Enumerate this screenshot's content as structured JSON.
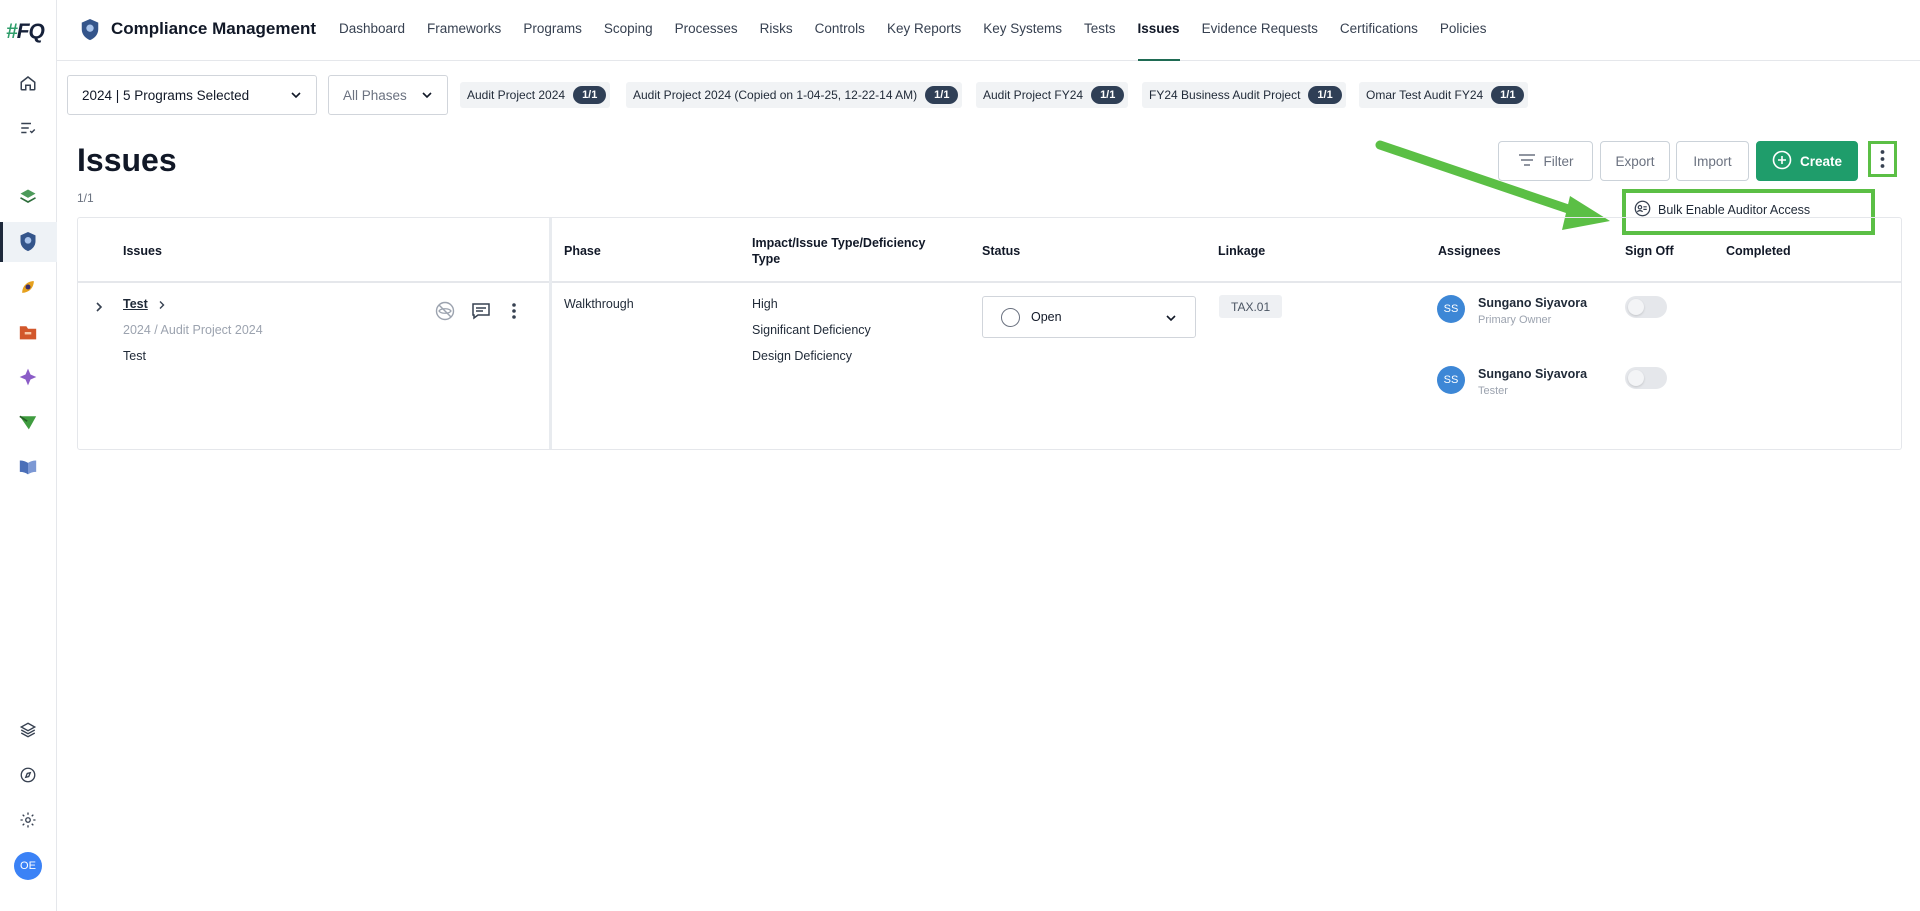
{
  "app": {
    "logo_hash": "#",
    "logo_text": "FQ",
    "title": "Compliance Management"
  },
  "nav": [
    {
      "label": "Dashboard"
    },
    {
      "label": "Frameworks"
    },
    {
      "label": "Programs"
    },
    {
      "label": "Scoping"
    },
    {
      "label": "Processes"
    },
    {
      "label": "Risks"
    },
    {
      "label": "Controls"
    },
    {
      "label": "Key Reports"
    },
    {
      "label": "Key Systems"
    },
    {
      "label": "Tests"
    },
    {
      "label": "Issues",
      "active": true
    },
    {
      "label": "Evidence Requests"
    },
    {
      "label": "Certifications"
    },
    {
      "label": "Policies"
    }
  ],
  "filters": {
    "program_select": "2024 | 5 Programs Selected",
    "phase_select": "All Phases",
    "chips": [
      {
        "label": "Audit Project 2024",
        "badge": "1/1"
      },
      {
        "label": "Audit Project 2024 (Copied on 1-04-25, 12-22-14 AM)",
        "badge": "1/1"
      },
      {
        "label": "Audit Project FY24",
        "badge": "1/1"
      },
      {
        "label": "FY24 Business Audit Project",
        "badge": "1/1"
      },
      {
        "label": "Omar Test Audit FY24",
        "badge": "1/1"
      }
    ]
  },
  "page": {
    "title": "Issues",
    "count": "1/1"
  },
  "toolbar": {
    "filter": "Filter",
    "export": "Export",
    "import": "Import",
    "create": "Create"
  },
  "menu": {
    "bulk_enable": "Bulk Enable Auditor Access"
  },
  "table": {
    "headers": {
      "issues": "Issues",
      "phase": "Phase",
      "impact_line1": "Impact/Issue Type/Deficiency",
      "impact_line2": "Type",
      "status": "Status",
      "linkage": "Linkage",
      "assignees": "Assignees",
      "signoff": "Sign Off",
      "completed": "Completed"
    },
    "row": {
      "name": "Test",
      "path": "2024 / Audit Project 2024",
      "description": "Test",
      "phase": "Walkthrough",
      "impact": "High",
      "issue_type": "Significant Deficiency",
      "deficiency_type": "Design Deficiency",
      "status": "Open",
      "linkage": "TAX.01",
      "assignees": [
        {
          "initials": "SS",
          "name": "Sungano Siyavora",
          "role": "Primary Owner"
        },
        {
          "initials": "SS",
          "name": "Sungano Siyavora",
          "role": "Tester"
        }
      ]
    }
  },
  "user": {
    "initials": "OE"
  },
  "colors": {
    "accent": "#1f9d6b",
    "highlight": "#5bbf45",
    "badge": "#2f3f56"
  }
}
